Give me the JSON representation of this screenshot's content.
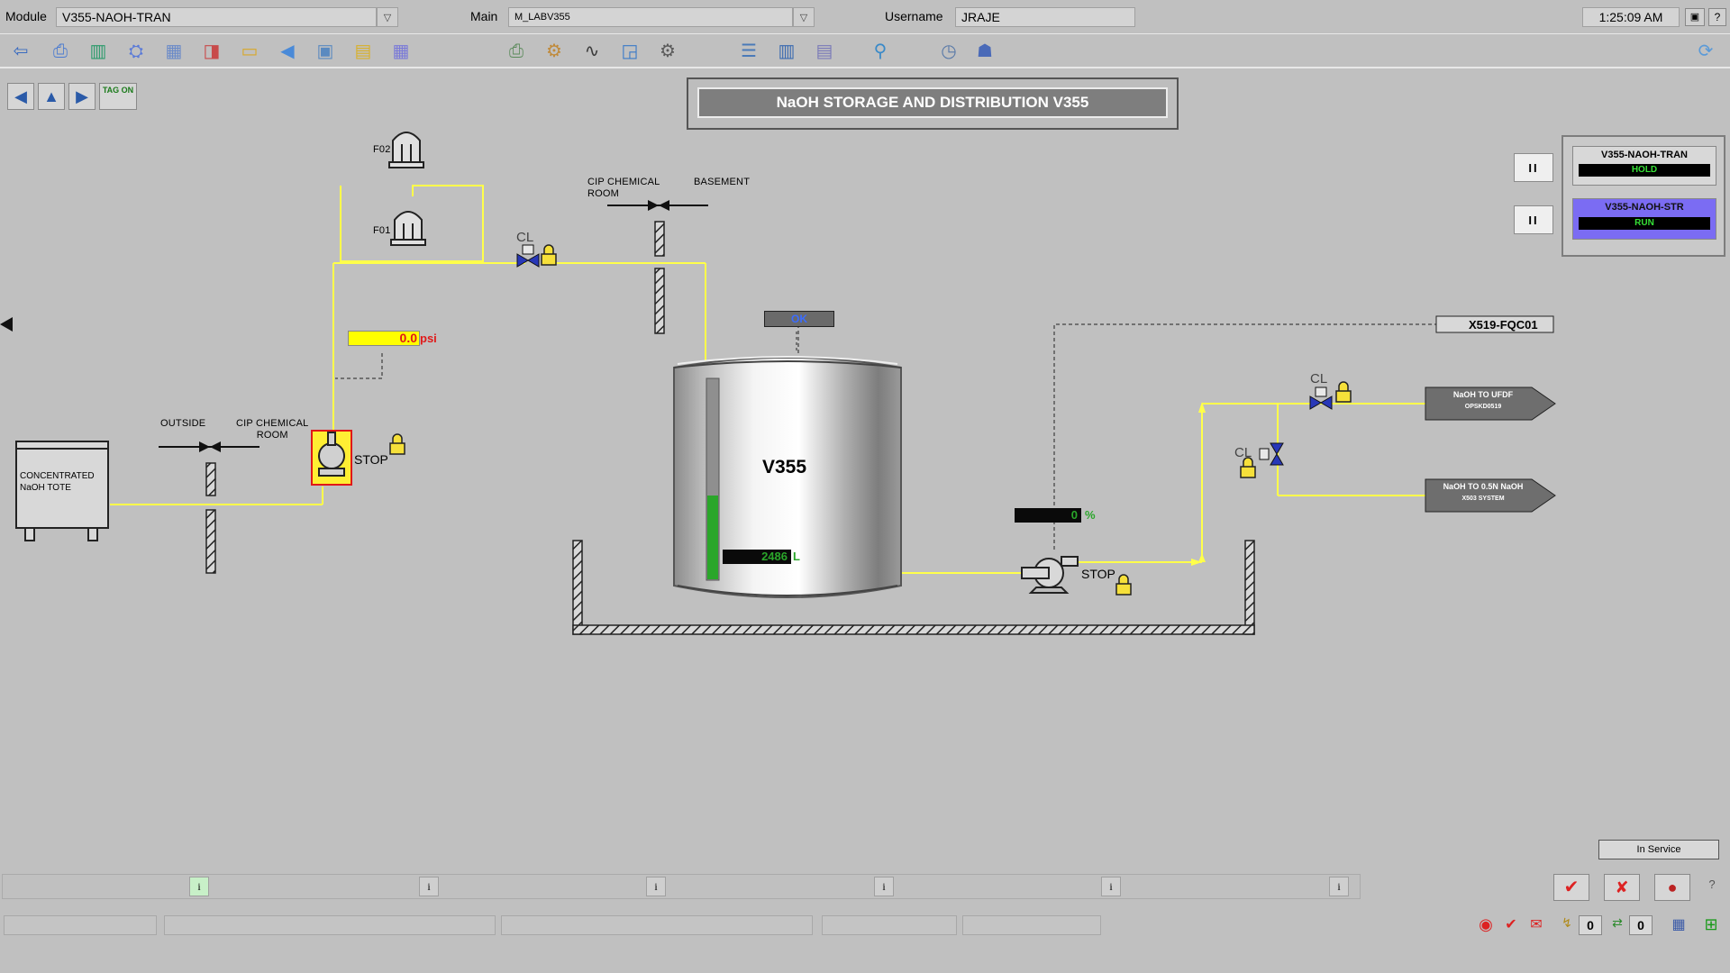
{
  "header": {
    "module_label": "Module",
    "module_value": "V355-NAOH-TRAN",
    "main_label": "Main",
    "main_value": "M_LABV355",
    "username_label": "Username",
    "username_value": "JRAJE",
    "clock": "1:25:09 AM"
  },
  "toolbar": {
    "icons": [
      "exit-icon",
      "print-icon",
      "chart-bars-icon",
      "network-icon",
      "layout-icon",
      "book-icon",
      "folder-icon",
      "back-icon",
      "window-icon",
      "notes-icon",
      "table-icon",
      "printer2-icon",
      "users-icon",
      "trend-icon",
      "graph-icon",
      "gears-icon",
      "list-icon",
      "dashboard-icon",
      "report-icon",
      "search-user-icon",
      "clock-icon",
      "sync-icon",
      "refresh-icon"
    ],
    "tag_on_label": "TAG ON"
  },
  "title": "NaOH STORAGE AND DISTRIBUTION V355",
  "status_panel": {
    "units": [
      {
        "name": "V355-NAOH-TRAN",
        "state": "HOLD"
      },
      {
        "name": "V355-NAOH-STR",
        "state": "RUN"
      }
    ],
    "pause_label": "II"
  },
  "process": {
    "filter_top": "F02",
    "filter_bottom": "F01",
    "valve1_label": "CL",
    "valve2_label": "CL",
    "valve3_label": "CL",
    "pressure_value": "0.0",
    "pressure_unit": "psi",
    "room1_label": "CIP CHEMICAL\nROOM",
    "basement_label": "BASEMENT",
    "outside_label": "OUTSIDE",
    "room2_label": "CIP CHEMICAL\nROOM",
    "tote_label": "CONCENTRATED\nNaOH TOTE",
    "pump1_status": "STOP",
    "pump2_status": "STOP",
    "tank_name": "V355",
    "tank_status": "OK",
    "tank_level_value": "2486",
    "tank_level_unit": "L",
    "tank_level_fraction": 0.42,
    "flow_percent_value": "0",
    "flow_percent_unit": "%",
    "fqc_tag": "X519-FQC01",
    "dest1_line1": "NaOH TO UFDF",
    "dest1_line2": "OPSKD0519",
    "dest2_line1": "NaOH TO 0.5N NaOH",
    "dest2_line2": "X503 SYSTEM"
  },
  "footer": {
    "in_service": "In Service",
    "info_glyph": "i",
    "counter1": "0",
    "counter2": "0",
    "help_glyph": "?"
  },
  "colors": {
    "line_yellow": "#ffff4a",
    "lock_yellow": "#f6e03a",
    "valve_blue": "#2838b8",
    "hold_green": "#36e036",
    "run_panel": "#7b6cf3"
  }
}
